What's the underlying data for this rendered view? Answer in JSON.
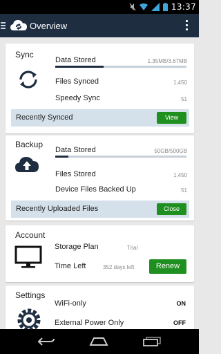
{
  "status_bar": {
    "time": "13:37"
  },
  "app_bar": {
    "title": "Overview"
  },
  "sync": {
    "title": "Sync",
    "data_stored_label": "Data Stored",
    "data_stored_value": "1.35MB/3.67MB",
    "data_stored_fraction": 0.37,
    "files_synced_label": "Files Synced",
    "files_synced_value": "1,450",
    "speedy_sync_label": "Speedy Sync",
    "speedy_sync_value": "51",
    "footer_label": "Recently Synced",
    "footer_button": "View"
  },
  "backup": {
    "title": "Backup",
    "data_stored_label": "Data Stored",
    "data_stored_value": "50GB/500GB",
    "data_stored_fraction": 0.1,
    "files_stored_label": "Files Stored",
    "files_stored_value": "1,450",
    "device_files_label": "Device Files Backed Up",
    "device_files_value": "51",
    "footer_label": "Recently Uploaded Files",
    "footer_button": "Close"
  },
  "account": {
    "title": "Account",
    "storage_plan_label": "Storage Plan",
    "storage_plan_value": "Trial",
    "time_left_label": "Time Left",
    "time_left_value": "352 days left",
    "renew_button": "Renew"
  },
  "settings": {
    "title": "Settings",
    "wifi_label": "WiFi-only",
    "wifi_value": "ON",
    "power_label": "External Power Only",
    "power_value": "OFF"
  },
  "colors": {
    "app_bar": "#1e2d40",
    "accent_green": "#1f8f1f",
    "footer_bar": "#d5e1ea",
    "background": "#e8e8e8"
  },
  "icons": {
    "status": [
      "muted-icon",
      "wifi-icon",
      "signal-icon",
      "battery-icon"
    ],
    "app_bar": [
      "menu-icon",
      "cloud-sync-logo-icon",
      "overflow-menu-icon"
    ],
    "cards": [
      "sync-arrows-icon",
      "cloud-upload-icon",
      "monitor-icon",
      "gear-icon"
    ],
    "nav": [
      "back-icon",
      "home-icon",
      "recent-apps-icon"
    ]
  }
}
